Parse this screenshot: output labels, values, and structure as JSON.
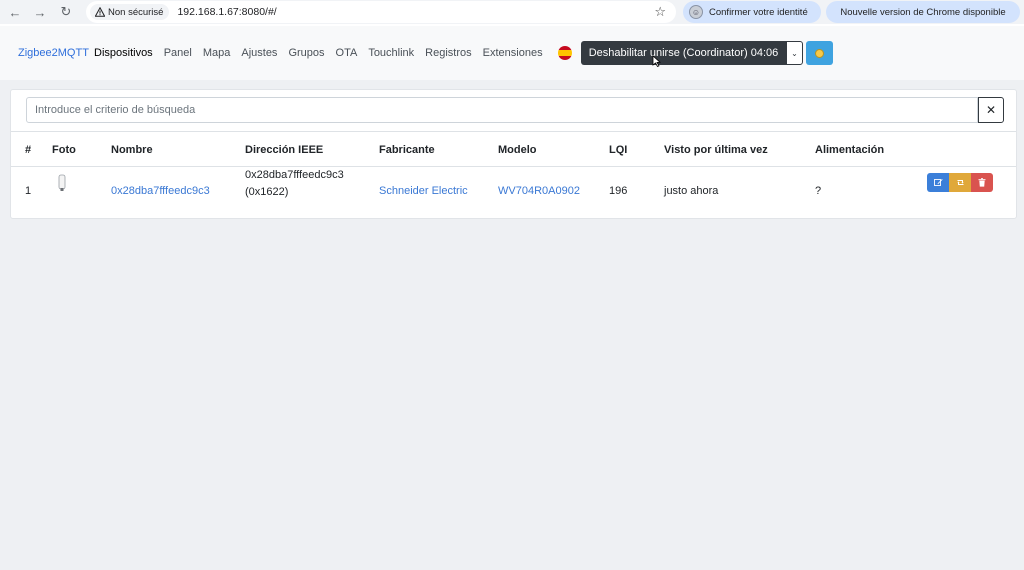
{
  "browser": {
    "insecure_label": "Non sécurisé",
    "url": "192.168.1.67:8080/#/",
    "profile_label": "Confirmer votre identité",
    "update_label": "Nouvelle version de Chrome disponible"
  },
  "navbar": {
    "brand": "Zigbee2MQTT",
    "links": [
      "Dispositivos",
      "Panel",
      "Mapa",
      "Ajustes",
      "Grupos",
      "OTA",
      "Touchlink",
      "Registros",
      "Extensiones"
    ],
    "active_link": "Dispositivos",
    "join_button": "Deshabilitar unirse (Coordinator) 04:06"
  },
  "search": {
    "placeholder": "Introduce el criterio de búsqueda",
    "value": ""
  },
  "table": {
    "headers": [
      "#",
      "Foto",
      "Nombre",
      "Dirección IEEE",
      "Fabricante",
      "Modelo",
      "LQI",
      "Visto por última vez",
      "Alimentación"
    ],
    "rows": [
      {
        "index": "1",
        "name": "0x28dba7fffeedc9c3",
        "ieee": "0x28dba7fffeedc9c3",
        "network_address": "(0x1622)",
        "manufacturer": "Schneider Electric",
        "model": "WV704R0A0902",
        "lqi": "196",
        "last_seen": "justo ahora",
        "power": "?"
      }
    ]
  },
  "colors": {
    "accent": "#3a78d4",
    "join_button_bg": "#343a40",
    "edit": "#3b7fd9",
    "reconfigure": "#e0a83a",
    "delete": "#d9534f"
  }
}
